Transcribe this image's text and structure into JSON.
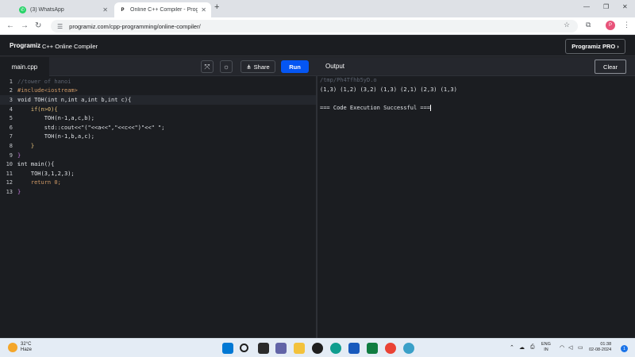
{
  "browser": {
    "tabs": [
      {
        "title": "(3) WhatsApp",
        "active": false
      },
      {
        "title": "Online C++ Compiler - Programiz",
        "active": true
      }
    ],
    "new_tab": "+",
    "url": "programiz.com/cpp-programming/online-compiler/"
  },
  "app": {
    "logo": "Programiz",
    "title": "C++ Online Compiler",
    "pro_button": "Programiz PRO ›"
  },
  "toolbar": {
    "file_tab": "main.cpp",
    "share_label": "Share",
    "run_label": "Run",
    "output_label": "Output",
    "clear_label": "Clear"
  },
  "editor": {
    "lines": [
      {
        "n": "1",
        "text": "//tower of hanoi"
      },
      {
        "n": "2",
        "text": "#include<iostream>"
      },
      {
        "n": "3",
        "text": "void TOH(int n,int a,int b,int c){"
      },
      {
        "n": "4",
        "text": "    if(n>0){"
      },
      {
        "n": "5",
        "text": "        TOH(n-1,a,c,b);"
      },
      {
        "n": "6",
        "text": "        std::cout<<\"(\"<<a<<\",\"<<c<<\")\"<<\" \";"
      },
      {
        "n": "7",
        "text": "        TOH(n-1,b,a,c);"
      },
      {
        "n": "8",
        "text": "    }"
      },
      {
        "n": "9",
        "text": "}"
      },
      {
        "n": "10",
        "text": "int main(){"
      },
      {
        "n": "11",
        "text": "    TOH(3,1,2,3);"
      },
      {
        "n": "12",
        "text": "    return 0;"
      },
      {
        "n": "13",
        "text": "}"
      }
    ]
  },
  "output": {
    "path": "/tmp/Ph4Tfhb5yD.o",
    "result": "(1,3) (1,2) (3,2) (1,3) (2,1) (2,3) (1,3)",
    "status": "=== Code Execution Successful ==="
  },
  "taskbar": {
    "temperature": "32°C",
    "weather": "Haze",
    "lang_1": "ENG",
    "lang_2": "IN",
    "time": "01:38",
    "date": "02-08-2024",
    "notification_count": "1"
  },
  "colors": {
    "run_button": "#0556f3",
    "editor_bg": "#1b1d21"
  }
}
